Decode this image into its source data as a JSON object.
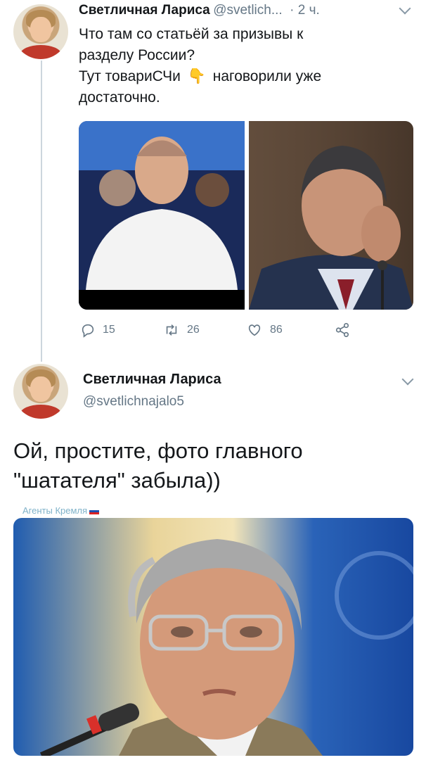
{
  "tweet1": {
    "author_name": "Светличная Лариса",
    "handle": "@svetlich...",
    "time": "· 2 ч.",
    "text_lines": [
      "Что там со статьёй за призывы к",
      "разделу России?",
      "Тут товариСЧи",
      "наговорили уже",
      "достаточно."
    ],
    "emoji": "👇",
    "reply_count": "15",
    "retweet_count": "26",
    "like_count": "86"
  },
  "tweet2": {
    "author_name": "Светличная Лариса",
    "handle": "@svetlichnajalo5",
    "text_lines": [
      "Ой, простите, фото главного",
      "\"шатателя\" забыла))"
    ],
    "watermark": "Агенты Кремля"
  },
  "colors": {
    "text": "#14171a",
    "secondary": "#657786",
    "divider": "#ccd6dd"
  }
}
